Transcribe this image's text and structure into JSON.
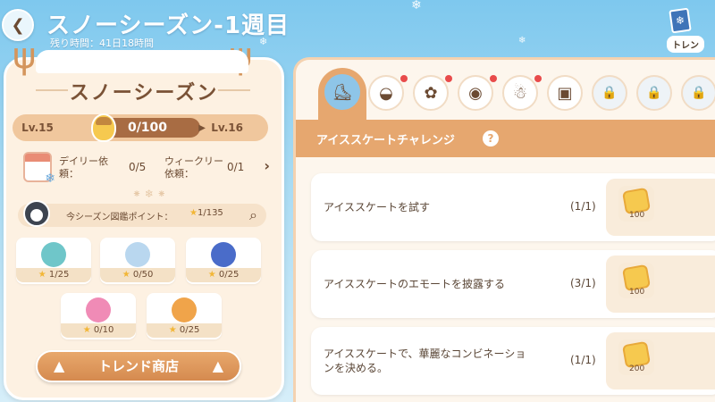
{
  "header": {
    "title": "スノーシーズン-1週目",
    "remaining": "残り時間：41日18時間",
    "trend_label": "トレン"
  },
  "season_panel": {
    "name": "スノーシーズン",
    "level_current": "Lv.15",
    "level_next": "Lv.16",
    "progress_text": "0/100",
    "progress_fraction": 0.0,
    "daily_label": "デイリー依頼：",
    "daily_value": "0/5",
    "weekly_label": "ウィークリー依頼：",
    "weekly_value": "0/1",
    "points_label": "今シーズン図鑑ポイント：",
    "points_value": "1/135",
    "collections": [
      {
        "icon": "penguin-float-icon",
        "count": "1/25",
        "color": "#6fc6c9"
      },
      {
        "icon": "shell-icon",
        "count": "0/50",
        "color": "#b9d7ef"
      },
      {
        "icon": "butterfly-icon",
        "count": "0/25",
        "color": "#4a6cc9"
      },
      {
        "icon": "donut-icon",
        "count": "0/10",
        "color": "#f08bb6"
      },
      {
        "icon": "bird-icon",
        "count": "0/25",
        "color": "#f0a44a"
      }
    ],
    "shop_button": "トレンド商店"
  },
  "tabs": [
    {
      "icon": "ice-skate-icon",
      "active": true,
      "locked": false,
      "dot": false
    },
    {
      "icon": "pot-icon",
      "active": false,
      "locked": false,
      "dot": true
    },
    {
      "icon": "watering-can-icon",
      "active": false,
      "locked": false,
      "dot": true
    },
    {
      "icon": "record-icon",
      "active": false,
      "locked": false,
      "dot": true
    },
    {
      "icon": "snowman-icon",
      "active": false,
      "locked": false,
      "dot": true
    },
    {
      "icon": "picture-icon",
      "active": false,
      "locked": false,
      "dot": false
    },
    {
      "icon": "lock-icon",
      "active": false,
      "locked": true,
      "dot": false
    },
    {
      "icon": "lock-icon",
      "active": false,
      "locked": true,
      "dot": false
    },
    {
      "icon": "lock-icon",
      "active": false,
      "locked": true,
      "dot": false
    }
  ],
  "challenge": {
    "title": "アイススケートチャレンジ",
    "help": "?",
    "missions": [
      {
        "text": "アイススケートを試す",
        "progress": "(1/1)",
        "reward_amount": "100"
      },
      {
        "text": "アイススケートのエモートを披露する",
        "progress": "(3/1)",
        "reward_amount": "100"
      },
      {
        "text": "アイススケートで、華麗なコンビネーションを決める。",
        "progress": "(1/1)",
        "reward_amount": "200"
      }
    ]
  },
  "colors": {
    "accent": "#e6a76f",
    "panel_bg": "#fdf1e2",
    "sky": "#7ec8ee"
  }
}
